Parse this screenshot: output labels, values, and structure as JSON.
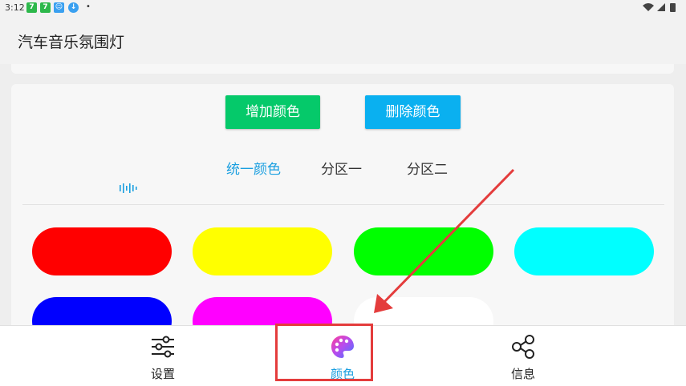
{
  "status_bar": {
    "time": "3:12",
    "notif_icons": [
      "app-7-icon",
      "app-7-icon",
      "chat-icon",
      "download-icon"
    ],
    "right_icons": [
      "wifi-icon",
      "signal-icon",
      "battery-icon"
    ]
  },
  "app_bar": {
    "title": "汽车音乐氛围灯"
  },
  "actions": {
    "add_label": "增加颜色",
    "delete_label": "删除颜色"
  },
  "tabs": [
    {
      "label": "统一颜色",
      "active": true
    },
    {
      "label": "分区一",
      "active": false
    },
    {
      "label": "分区二",
      "active": false
    }
  ],
  "swatches": [
    "#ff0000",
    "#ffff00",
    "#00ff00",
    "#00ffff",
    "#0000ff",
    "#ff00ff",
    "#ffffff"
  ],
  "bottom_nav": [
    {
      "label": "设置",
      "icon": "sliders-icon",
      "active": false
    },
    {
      "label": "颜色",
      "icon": "palette-icon",
      "active": true
    },
    {
      "label": "信息",
      "icon": "share-icon",
      "active": false
    }
  ],
  "colors": {
    "accent_blue": "#1a9fe0",
    "add_green": "#05c96a",
    "delete_blue": "#0ab0f0",
    "annotation_red": "#e43c3c"
  }
}
